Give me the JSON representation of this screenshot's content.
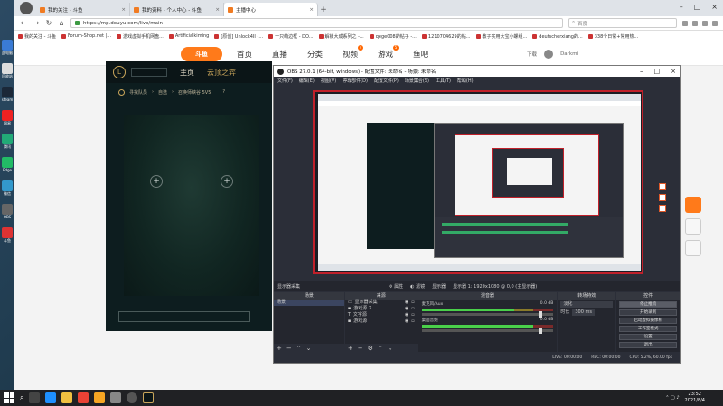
{
  "browser": {
    "tabs": [
      {
        "label": "我的关注 - 斗鱼",
        "active": false
      },
      {
        "label": "我的资料 - 个人中心 - 斗鱼",
        "active": false
      },
      {
        "label": "主播中心",
        "active": true
      }
    ],
    "url": "https://mp.douyu.com/live/main",
    "search_placeholder": "百度",
    "bookmarks": [
      "我的关注 - 斗鱼",
      "Forum-Shop.net |...",
      "游戏虚拟手机网盘...",
      "Artificialkiming",
      "[原创] Unlock4II (...",
      "一只萌边框 - DO...",
      "解锁大成系列之 -...",
      "qege008的帖子 -...",
      "1210704629的帖...",
      "教子实用大宝小螺组...",
      "deutscherxiang的...",
      "338个日常+常用热..."
    ]
  },
  "site": {
    "logo_text": "斗鱼",
    "nav": [
      {
        "label": "首页",
        "badge": ""
      },
      {
        "label": "直播",
        "badge": ""
      },
      {
        "label": "分类",
        "badge": ""
      },
      {
        "label": "视频",
        "badge": "4"
      },
      {
        "label": "游戏",
        "badge": "5"
      },
      {
        "label": "鱼吧",
        "badge": ""
      }
    ],
    "download_label": "下载",
    "username": "Darkmi"
  },
  "game": {
    "nav_home": "主页",
    "nav_tft": "云顶之弈",
    "sub_items": [
      "寻找队员",
      "自选",
      "召唤师峡谷 5V5"
    ]
  },
  "obs": {
    "title": "OBS 27.0.1 (64-bit, windows) - 配置文件: 未命名 - 场景: 未命名",
    "menu": [
      "文件(F)",
      "编辑(E)",
      "视图(V)",
      "停靠部件(D)",
      "配置文件(P)",
      "场景集合(S)",
      "工具(T)",
      "帮助(H)"
    ],
    "source_bar": {
      "selected": "显示器采集",
      "props_label": "属性",
      "filter_label": "滤镜",
      "display_label": "显示器",
      "display_value": "显示器 1: 1920x1080 @ 0,0 (主显示器)"
    },
    "docks": {
      "scenes": {
        "header": "场景",
        "items": [
          "场景"
        ]
      },
      "sources": {
        "header": "来源",
        "items": [
          "显示器采集",
          "游戏源 2",
          "文字源",
          "游戏源"
        ]
      },
      "mixer": {
        "header": "混音器",
        "channels": [
          {
            "name": "麦克风/Aux",
            "db": "0.0 dB",
            "level": 0.7
          },
          {
            "name": "桌面音频",
            "db": "0.0 dB",
            "level": 0.85
          }
        ]
      },
      "transitions": {
        "header": "转场特效",
        "type": "淡化",
        "duration_label": "时长",
        "duration_value": "300 ms"
      },
      "controls": {
        "header": "控件",
        "buttons": [
          "停止推流",
          "开始录制",
          "启动虚拟摄像机",
          "工作室模式",
          "设置",
          "退出"
        ]
      }
    },
    "status": {
      "live": "LIVE: 00:00:00",
      "rec": "REC: 00:00:00",
      "cpu": "CPU: 5.2%, 60.00 fps"
    }
  },
  "taskbar": {
    "time": "23:52",
    "date": "2021/8/4"
  },
  "colors": {
    "douyu_orange": "#ff7a1a",
    "obs_bg": "#2b2e38",
    "preview_border": "#c0202a",
    "taskbar": "#202124"
  }
}
